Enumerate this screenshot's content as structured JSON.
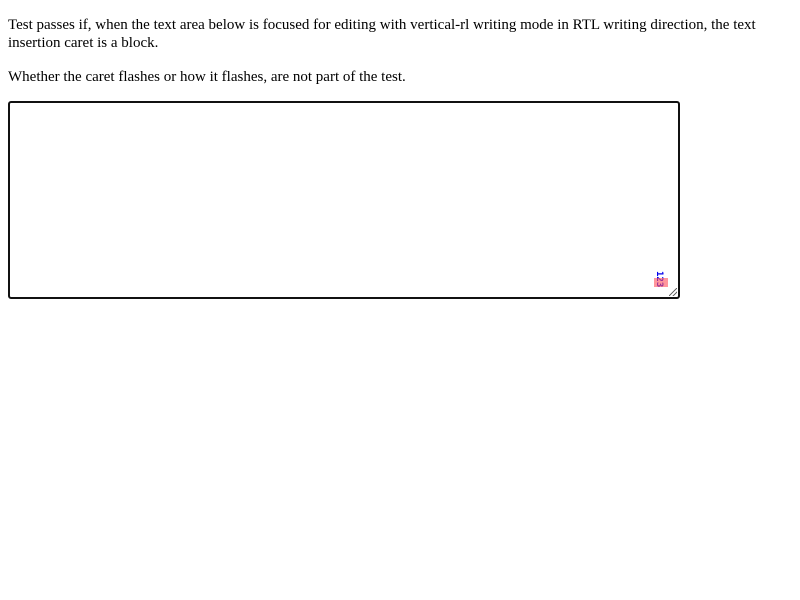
{
  "instructions": {
    "line1": "Test passes if, when the text area below is focused for editing with vertical-rl writing mode in RTL writing direction, the text insertion caret is a block.",
    "line2": "Whether the caret flashes or how it flashes, are not part of the test."
  },
  "textarea": {
    "value": "123"
  }
}
